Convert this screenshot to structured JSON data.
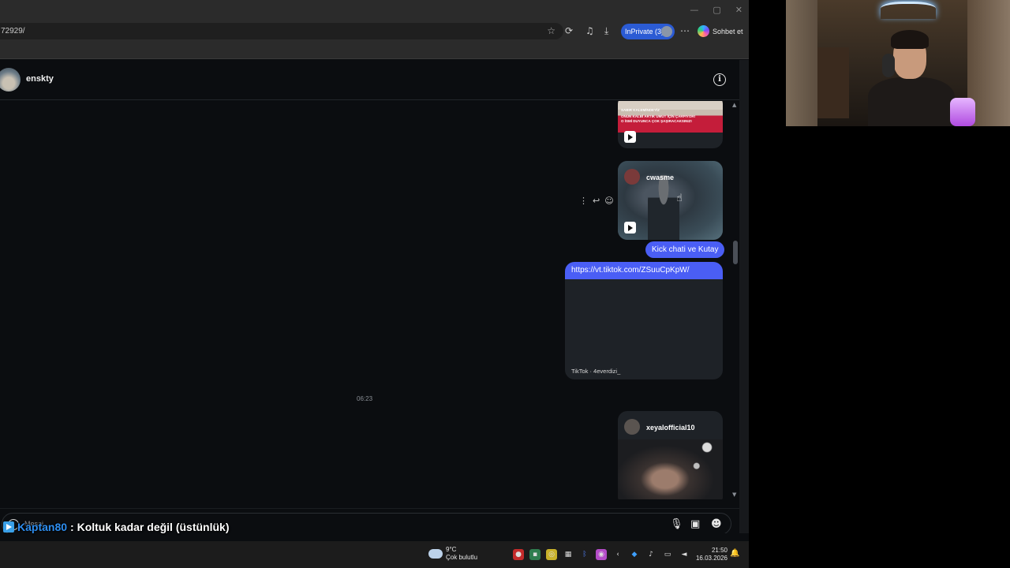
{
  "browser": {
    "url": "72929/",
    "inprivate_label": "InPrivate (3)",
    "chat_button_label": "Sohbet et",
    "window_controls": [
      "—",
      "▢",
      "✕"
    ]
  },
  "chat": {
    "header": {
      "username": "enskty"
    },
    "messages": {
      "card1": {
        "banner_lines": [
          "SABIR KALEMİNDEYİZ",
          "ONUN KALBİ ARTIK UMUT İÇİN ÇARPIYOR!",
          "O İSMİ DUYUNCA ÇOK ŞAŞIRACAKSINIZ!"
        ]
      },
      "card2": {
        "author": "cwasme"
      },
      "kick_text": "Kick chati ve Kutay",
      "link": {
        "url": "https://vt.tiktok.com/ZSuuCpKpW/",
        "footer": "TikTok · 4everdizi_"
      },
      "timestamp": "06:23",
      "card3": {
        "author": "xeyalofficial10"
      }
    },
    "composer": {
      "placeholder": "Mesaj..."
    }
  },
  "overlay": {
    "user": "Kaptan80",
    "message": ": Koltuk kadar değil (üstünlük)"
  },
  "taskbar": {
    "temperature": "9°C",
    "weather": "Çok bulutlu",
    "time": "21:50",
    "date": "16.03.2026"
  },
  "colors": {
    "accent_bubble": "#4a5ef5",
    "inprivate": "#2b5bd4",
    "page_bg": "#0b0d10"
  },
  "icons": [
    "star-icon",
    "refresh-icon",
    "extension-icon",
    "download-icon",
    "more-icon",
    "copilot-icon",
    "info-icon",
    "play-icon",
    "reply-icon",
    "emoji-icon",
    "more-vertical-icon",
    "microphone-icon",
    "image-icon",
    "sticker-icon",
    "cloud-icon",
    "bell-icon"
  ]
}
